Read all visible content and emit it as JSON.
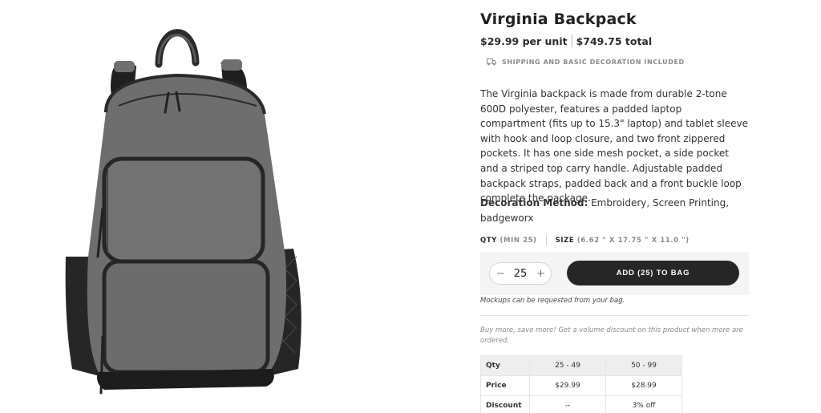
{
  "product": {
    "title": "Virginia Backpack",
    "unit_price": "$29.99 per unit",
    "total_price": "$749.75 total",
    "shipping_note": "SHIPPING AND BASIC DECORATION INCLUDED",
    "description": "The Virginia backpack is made from durable 2-tone 600D polyester, features a padded laptop compartment (fits up to 15.3\" laptop) and tablet sleeve with hook and loop closure, and two front zippered pockets. It has one side mesh pocket, a side pocket and a striped top carry handle. Adjustable padded backpack straps, padded back and a front buckle loop complete the package.",
    "decoration_label": "Decoration Method:",
    "decoration_value": " Embroidery, Screen Printing, badgeworx"
  },
  "specs": {
    "qty_label": "QTY",
    "qty_min": "(MIN 25)",
    "size_label": "SIZE",
    "size_value": "(6.62 \" X 17.75 \" X 11.0 \")"
  },
  "cart": {
    "decrement": "−",
    "quantity": "25",
    "increment": "+",
    "add_button": "ADD (25) TO BAG",
    "mockup_note": "Mockups can be requested from your bag."
  },
  "volume": {
    "note": "Buy more, save more! Get a volume discount on this product when more are ordered.",
    "rows": [
      {
        "label": "Qty",
        "cells": [
          "25 - 49",
          "50 - 99"
        ]
      },
      {
        "label": "Price",
        "cells": [
          "$29.99",
          "$28.99"
        ]
      },
      {
        "label": "Discount",
        "cells": [
          "--",
          "3% off"
        ]
      }
    ]
  },
  "icons": {
    "shipping": "truck-icon"
  },
  "colors": {
    "button_bg": "#262626",
    "panel_bg": "#f4f4f4",
    "backpack_body": "#6e6e6e",
    "backpack_trim": "#2a2a2a"
  }
}
